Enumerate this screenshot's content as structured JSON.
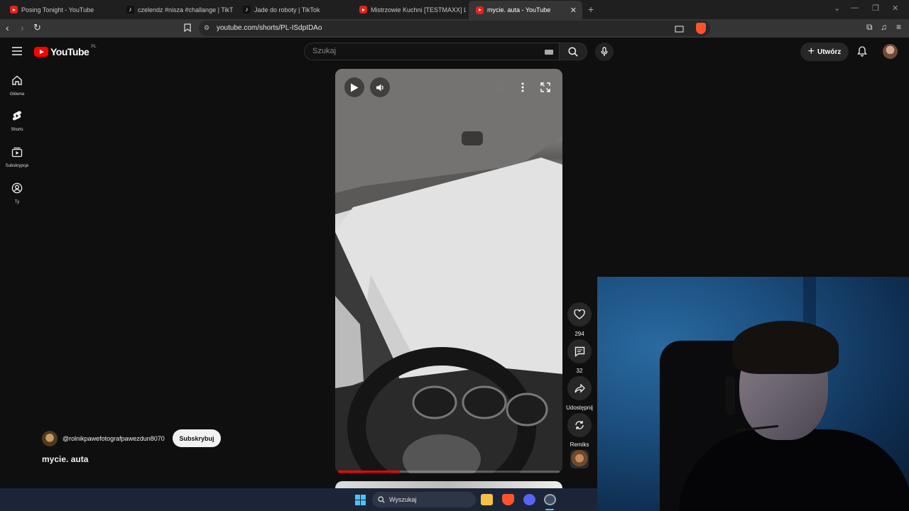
{
  "browser": {
    "tabs": [
      {
        "title": "Posing Tonight - YouTube",
        "icon": "youtube-icon",
        "active": false
      },
      {
        "title": "czelendz #nisza #challange | TikTok",
        "icon": "tiktok-icon",
        "active": false
      },
      {
        "title": "Jade do roboty | TikTok",
        "icon": "tiktok-icon",
        "active": false
      },
      {
        "title": "Mistrzowie Kuchni [TESTMAXX] Lukr",
        "icon": "youtube-icon",
        "active": false
      },
      {
        "title": "mycie. auta - YouTube",
        "icon": "youtube-icon",
        "active": true
      }
    ],
    "url": "youtube.com/shorts/PL-ISdpIDAo"
  },
  "youtube": {
    "logo_text": "YouTube",
    "region": "PL",
    "search_placeholder": "Szukaj",
    "create_label": "Utwórz",
    "guide": [
      {
        "label": "Główna",
        "icon": "home-icon"
      },
      {
        "label": "Shorts",
        "icon": "shorts-icon"
      },
      {
        "label": "Subskrypcje",
        "icon": "subscriptions-icon"
      },
      {
        "label": "Ty",
        "icon": "you-icon"
      }
    ]
  },
  "short": {
    "title": "mycie. auta",
    "channel": "@rolnikpawefotografpawezdun8070",
    "subscribe_label": "Subskrybuj",
    "likes": "294",
    "comments": "32",
    "share_label": "Udostępnij",
    "remix_label": "Remiks",
    "progress": 0.28
  },
  "taskbar": {
    "search_label": "Wyszukaj"
  },
  "colors": {
    "accent": "#ff0000",
    "background": "#0f0f0f",
    "taskbar": "#1c2538"
  }
}
